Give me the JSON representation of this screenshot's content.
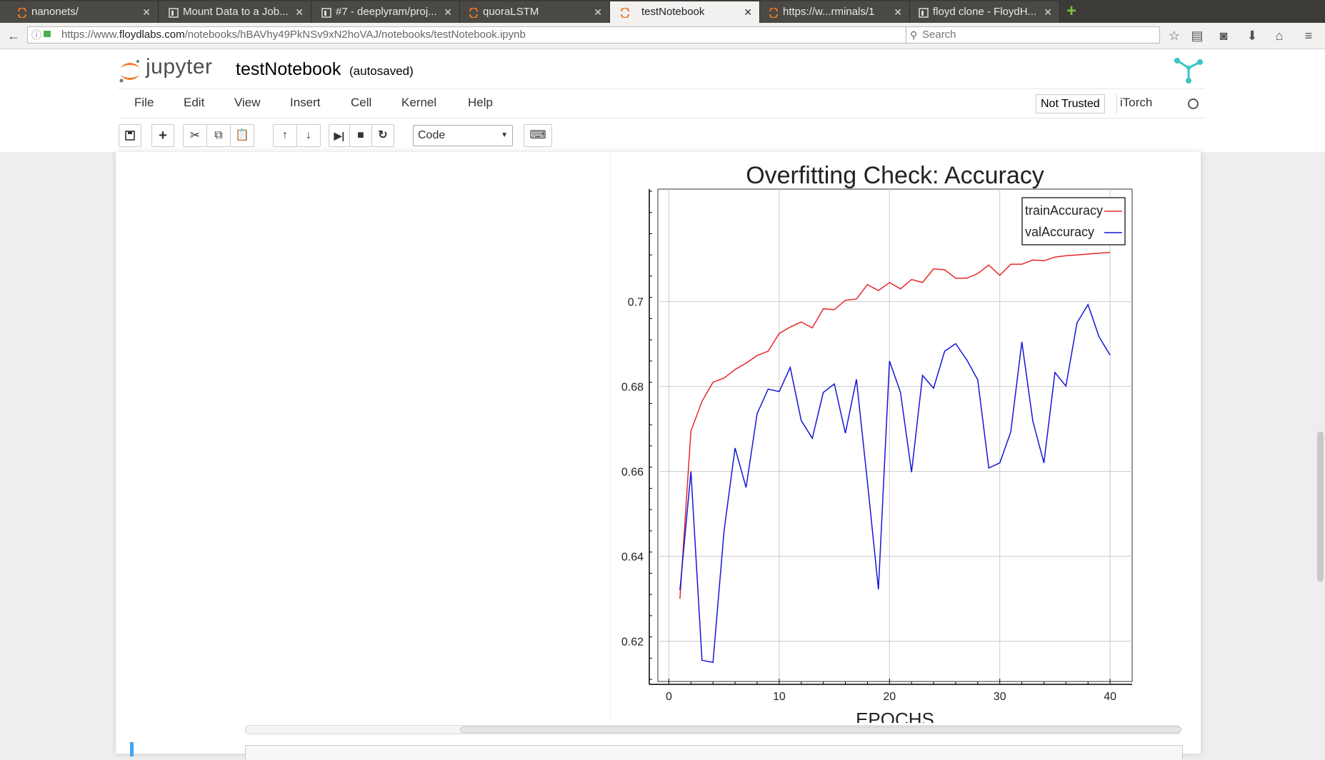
{
  "browser": {
    "tabs": [
      {
        "label": "nanonets/",
        "icon": "jupyter-icon",
        "active": false
      },
      {
        "label": "Mount Data to a Job...",
        "icon": "floyd-icon",
        "active": false
      },
      {
        "label": "#7 - deeplyram/proj...",
        "icon": "floyd-icon",
        "active": false
      },
      {
        "label": "quoraLSTM",
        "icon": "jupyter-icon",
        "active": false
      },
      {
        "label": "testNotebook",
        "icon": "jupyter-icon",
        "active": true
      },
      {
        "label": "https://w...rminals/1",
        "icon": "jupyter-icon",
        "active": false
      },
      {
        "label": "floyd clone - FloydH...",
        "icon": "floyd-icon",
        "active": false
      }
    ],
    "url_prefix": "https://www.",
    "url_domain": "floydlabs.com",
    "url_path": "/notebooks/hBAVhy49PkNSv9xN2hoVAJ/notebooks/testNotebook.ipynb",
    "search_placeholder": "Search"
  },
  "jupyter": {
    "logo_text": "jupyter",
    "notebook_title": "testNotebook",
    "autosave_status": "(autosaved)",
    "menu": [
      "File",
      "Edit",
      "View",
      "Insert",
      "Cell",
      "Kernel",
      "Help"
    ],
    "trust_label": "Not Trusted",
    "kernel_name": "iTorch",
    "cell_type": "Code"
  },
  "chart_data": {
    "type": "line",
    "title": "Overfitting Check: Accuracy",
    "xlabel": "EPOCHS",
    "ylabel": "",
    "xlim": [
      -1,
      42
    ],
    "ylim": [
      0.6105,
      0.7265
    ],
    "xticks": [
      0,
      10,
      20,
      30,
      40
    ],
    "yticks": [
      0.62,
      0.64,
      0.66,
      0.68,
      0.7
    ],
    "ytick_labels": [
      "0.62",
      "0.64",
      "0.66",
      "0.68",
      "0.7"
    ],
    "grid": true,
    "legend_position": "top-right",
    "x": [
      1,
      2,
      3,
      4,
      5,
      6,
      7,
      8,
      9,
      10,
      11,
      12,
      13,
      14,
      15,
      16,
      17,
      18,
      19,
      20,
      21,
      22,
      23,
      24,
      25,
      26,
      27,
      28,
      29,
      30,
      31,
      32,
      33,
      34,
      35,
      36,
      37,
      38,
      39,
      40
    ],
    "series": [
      {
        "name": "trainAccuracy",
        "color": "#e8262a",
        "values": [
          0.63,
          0.6695,
          0.6765,
          0.681,
          0.682,
          0.684,
          0.6855,
          0.6873,
          0.6883,
          0.6925,
          0.694,
          0.6952,
          0.6938,
          0.6983,
          0.6981,
          0.7003,
          0.7006,
          0.704,
          0.7026,
          0.7045,
          0.703,
          0.7052,
          0.7045,
          0.7077,
          0.7075,
          0.7055,
          0.7055,
          0.7066,
          0.7086,
          0.7062,
          0.7088,
          0.7088,
          0.7098,
          0.7096,
          0.7105,
          0.7108,
          0.711,
          0.7112,
          0.7114,
          0.7116
        ]
      },
      {
        "name": "valAccuracy",
        "color": "#1515d6",
        "values": [
          0.632,
          0.66,
          0.6155,
          0.615,
          0.646,
          0.6655,
          0.6562,
          0.6736,
          0.6794,
          0.6788,
          0.6845,
          0.672,
          0.6678,
          0.6786,
          0.6806,
          0.669,
          0.6817,
          0.6575,
          0.6322,
          0.686,
          0.6786,
          0.6598,
          0.6826,
          0.6796,
          0.6883,
          0.6901,
          0.6863,
          0.6816,
          0.6608,
          0.662,
          0.6693,
          0.6905,
          0.6718,
          0.662,
          0.6833,
          0.6801,
          0.695,
          0.6993,
          0.6917,
          0.6874
        ]
      }
    ]
  },
  "colors": {
    "accent": "#f37626",
    "plot_bg": "#ffffff",
    "grid": "#cccccc"
  }
}
